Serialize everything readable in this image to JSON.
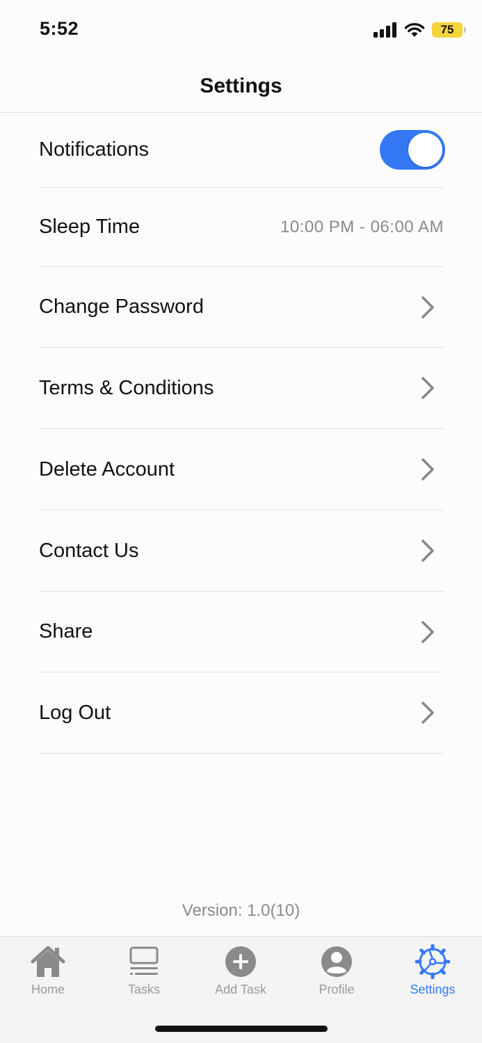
{
  "status_bar": {
    "time": "5:52",
    "battery": "75",
    "signal_icon": "cellular-signal-icon",
    "wifi_icon": "wifi-icon"
  },
  "header": {
    "title": "Settings"
  },
  "settings": {
    "notifications": {
      "label": "Notifications",
      "enabled": true
    },
    "sleep_time": {
      "label": "Sleep Time",
      "value": "10:00 PM - 06:00 AM"
    },
    "items": [
      {
        "label": "Change Password",
        "icon": "chevron-right-icon"
      },
      {
        "label": "Terms & Conditions",
        "icon": "chevron-right-icon"
      },
      {
        "label": "Delete Account",
        "icon": "chevron-right-icon"
      },
      {
        "label": "Contact Us",
        "icon": "chevron-right-icon"
      },
      {
        "label": "Share",
        "icon": "chevron-right-icon"
      },
      {
        "label": "Log Out",
        "icon": "chevron-right-icon"
      }
    ]
  },
  "version": "Version: 1.0(10)",
  "tab_bar": {
    "active": "Settings",
    "tabs": [
      {
        "label": "Home",
        "icon": "home-icon"
      },
      {
        "label": "Tasks",
        "icon": "tasks-icon"
      },
      {
        "label": "Add Task",
        "icon": "add-circle-icon"
      },
      {
        "label": "Profile",
        "icon": "profile-icon"
      },
      {
        "label": "Settings",
        "icon": "settings-gear-icon"
      }
    ]
  },
  "colors": {
    "accent": "#3478f6",
    "battery": "#f5d33b",
    "secondary_text": "#8a8a8a",
    "inactive_tab": "#9a9a9a"
  }
}
